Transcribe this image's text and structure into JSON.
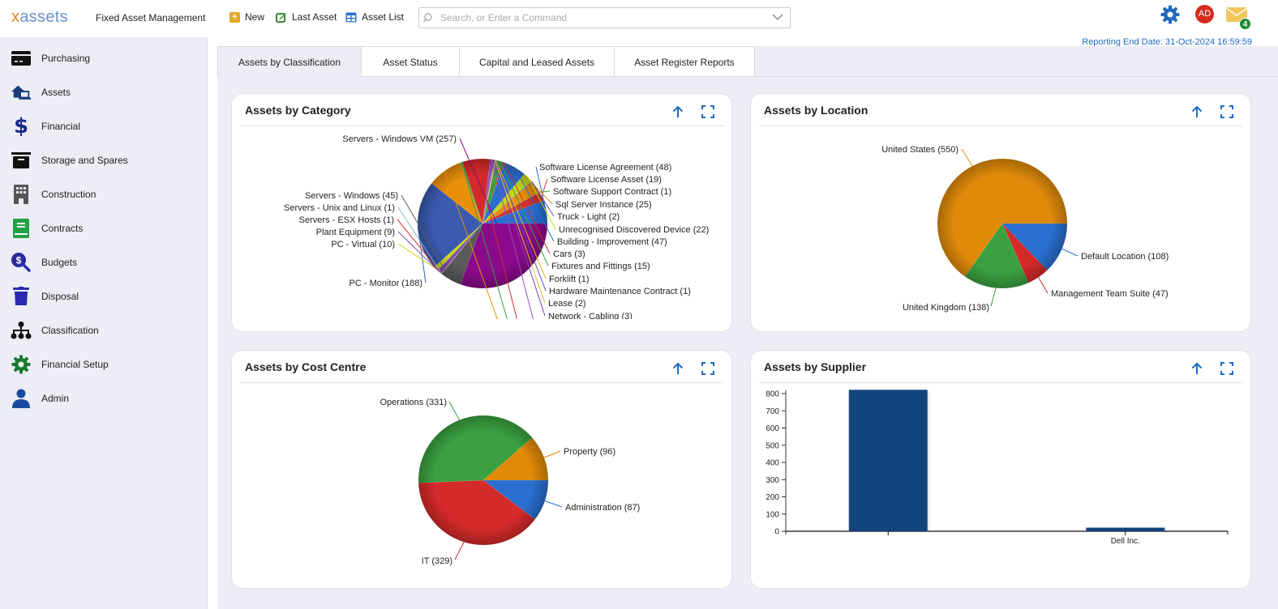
{
  "header": {
    "logo_x": "x",
    "logo_rest": "assets",
    "app_title": "Fixed Asset Management",
    "new_label": "New",
    "last_asset_label": "Last Asset",
    "asset_list_label": "Asset List",
    "search_placeholder": "Search, or Enter a Command",
    "user_initials": "AD",
    "mail_count": "4",
    "reporting_end_date": "Reporting End Date: 31-Oct-2024 16:59:59"
  },
  "sidebar": {
    "items": [
      {
        "label": "Purchasing",
        "icon": "credit-card-icon",
        "color": "#111111"
      },
      {
        "label": "Assets",
        "icon": "house-laptop-icon",
        "color": "#1a3a7a"
      },
      {
        "label": "Financial",
        "icon": "dollar-icon",
        "color": "#1a2a8a"
      },
      {
        "label": "Storage and Spares",
        "icon": "archive-box-icon",
        "color": "#111111"
      },
      {
        "label": "Construction",
        "icon": "building-icon",
        "color": "#555555"
      },
      {
        "label": "Contracts",
        "icon": "book-icon",
        "color": "#22a045"
      },
      {
        "label": "Budgets",
        "icon": "search-dollar-icon",
        "color": "#2a2aa0"
      },
      {
        "label": "Disposal",
        "icon": "trash-icon",
        "color": "#2a2ab0"
      },
      {
        "label": "Classification",
        "icon": "sitemap-icon",
        "color": "#111111"
      },
      {
        "label": "Financial Setup",
        "icon": "gear-icon",
        "color": "#1a7a2e"
      },
      {
        "label": "Admin",
        "icon": "user-icon",
        "color": "#1a4aa0"
      }
    ]
  },
  "tabs": [
    {
      "label": "Assets by Classification",
      "active": true
    },
    {
      "label": "Asset Status",
      "active": false
    },
    {
      "label": "Capital and Leased Assets",
      "active": false
    },
    {
      "label": "Asset Register Reports",
      "active": false
    }
  ],
  "colors": {
    "accent": "#1f6bbf",
    "bar": "#12447e"
  },
  "chart_data": [
    {
      "id": "category",
      "type": "pie",
      "title": "Assets by Category",
      "slices": [
        {
          "label": "Software License Agreement",
          "value": 48,
          "color": "#2a6fd0"
        },
        {
          "label": "Software License Asset",
          "value": 19,
          "color": "#d43030"
        },
        {
          "label": "Software Support Contract",
          "value": 1,
          "color": "#3aa040"
        },
        {
          "label": "Sql Server Instance",
          "value": 25,
          "color": "#e8900a"
        },
        {
          "label": "Truck - Light",
          "value": 2,
          "color": "#6a5ab0"
        },
        {
          "label": "Unrecognised Discovered Device",
          "value": 22,
          "color": "#c8d818"
        },
        {
          "label": "Building - Improvement",
          "value": 47,
          "color": "#2a6fd0"
        },
        {
          "label": "Cars",
          "value": 3,
          "color": "#c03030"
        },
        {
          "label": "Fixtures and Fittings",
          "value": 15,
          "color": "#3aa040"
        },
        {
          "label": "Forklift",
          "value": 1,
          "color": "#e8b020"
        },
        {
          "label": "Hardware Maintenance Contract",
          "value": 1,
          "color": "#5050c0"
        },
        {
          "label": "Lease",
          "value": 2,
          "color": "#e8c030"
        },
        {
          "label": "Network - Cabling",
          "value": 3,
          "color": "#8040b0"
        },
        {
          "label": null,
          "value": 6,
          "color": "#9050c0"
        },
        {
          "label": null,
          "value": 58,
          "color": "#d42a2a"
        },
        {
          "label": null,
          "value": 4,
          "color": "#3aa040"
        },
        {
          "label": null,
          "value": 75,
          "color": "#e8900a"
        },
        {
          "label": "PC - Monitor",
          "value": 188,
          "color": "#3a5ab0"
        },
        {
          "label": "PC - Virtual",
          "value": 10,
          "color": "#c8d818"
        },
        {
          "label": "Plant Equipment",
          "value": 9,
          "color": "#7a4ab0"
        },
        {
          "label": "Servers - ESX Hosts",
          "value": 1,
          "color": "#d43030"
        },
        {
          "label": "Servers - Unix and Linux",
          "value": 1,
          "color": "#8ab0d8"
        },
        {
          "label": "Servers - Windows",
          "value": 45,
          "color": "#5a5a5a"
        },
        {
          "label": "Servers - Windows VM",
          "value": 257,
          "color": "#8a0a8a"
        }
      ]
    },
    {
      "id": "location",
      "type": "pie",
      "title": "Assets by Location",
      "slices": [
        {
          "label": "Default Location",
          "value": 108,
          "color": "#2a6fd0"
        },
        {
          "label": "Management Team Suite",
          "value": 47,
          "color": "#d42a2a"
        },
        {
          "label": "United Kingdom",
          "value": 138,
          "color": "#3aa040"
        },
        {
          "label": "United States",
          "value": 550,
          "color": "#e08a0a"
        }
      ]
    },
    {
      "id": "costcentre",
      "type": "pie",
      "title": "Assets by Cost Centre",
      "slices": [
        {
          "label": "Administration",
          "value": 87,
          "color": "#2a6fd0"
        },
        {
          "label": "IT",
          "value": 329,
          "color": "#d42a2a"
        },
        {
          "label": "Operations",
          "value": 331,
          "color": "#3aa040"
        },
        {
          "label": "Property",
          "value": 96,
          "color": "#e08a0a"
        }
      ]
    },
    {
      "id": "supplier",
      "type": "bar",
      "title": "Assets by Supplier",
      "categories": [
        "",
        "Dell Inc."
      ],
      "values": [
        822,
        21
      ],
      "ylim": [
        0,
        800
      ],
      "yticks": [
        0,
        100,
        200,
        300,
        400,
        500,
        600,
        700,
        800
      ],
      "xlabel": "",
      "ylabel": ""
    }
  ]
}
